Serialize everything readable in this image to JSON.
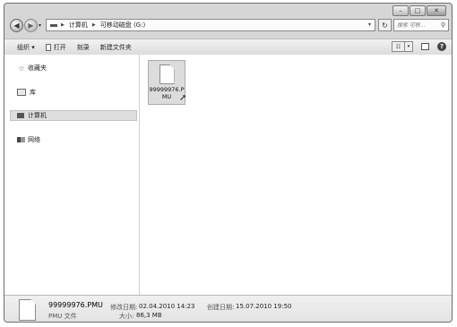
{
  "address": {
    "breadcrumbs": [
      "计算机",
      "可移动磁盘 (G:)"
    ],
    "search_placeholder": "搜索 可移..."
  },
  "toolbar": {
    "organize": "组织 ▾",
    "open": "打开",
    "burn": "刻录",
    "new_folder": "新建文件夹"
  },
  "navigation": {
    "favorites": "收藏夹",
    "libraries": "库",
    "computer": "计算机",
    "network": "网络"
  },
  "file": {
    "name": "99999976.PMU"
  },
  "details": {
    "name": "99999976.PMU",
    "modified_label": "修改日期:",
    "modified_value": "02.04.2010 14:23",
    "created_label": "创建日期:",
    "created_value": "15.07.2010 19:50",
    "type": "PMU 文件",
    "size_label": "大小:",
    "size_value": "86,3 MB"
  }
}
